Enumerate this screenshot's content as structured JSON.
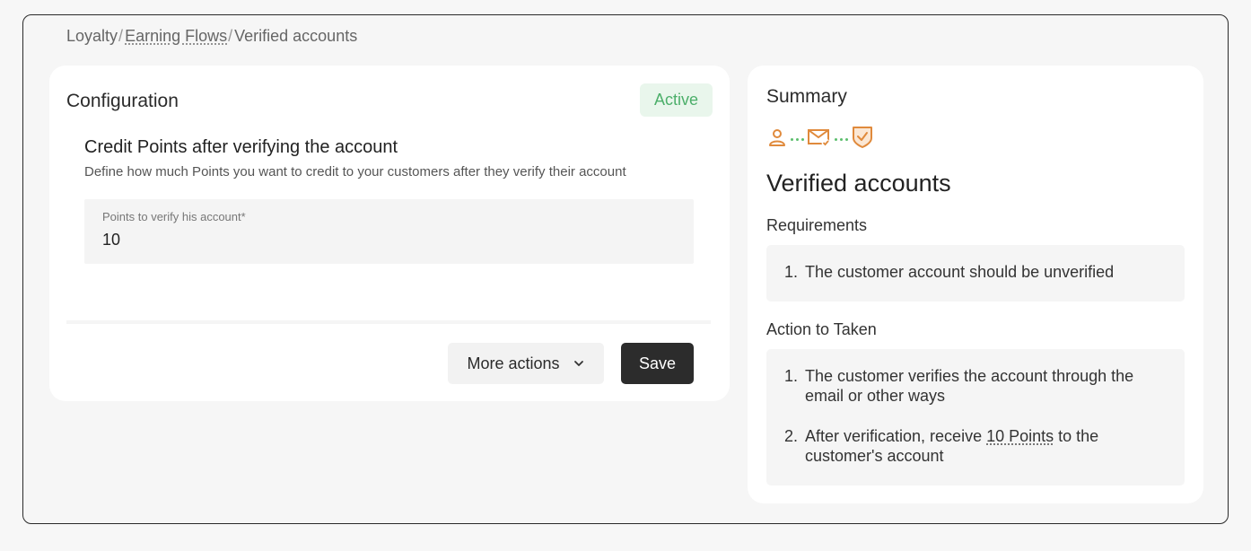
{
  "breadcrumb": {
    "items": [
      "Loyalty",
      "Earning Flows",
      "Verified accounts"
    ],
    "separator": "/"
  },
  "config": {
    "title": "Configuration",
    "status": "Active",
    "section_title": "Credit Points after verifying the account",
    "section_desc": "Define how much Points you want to credit to your customers after they verify their account",
    "field_label": "Points to verify his account*",
    "field_value": "10",
    "more_actions_label": "More actions",
    "save_label": "Save"
  },
  "summary": {
    "title": "Summary",
    "flow_icons": [
      "user-icon",
      "email-check-icon",
      "shield-check-icon"
    ],
    "heading": "Verified accounts",
    "requirements_label": "Requirements",
    "requirements": [
      {
        "num": "1.",
        "text": "The customer account should be unverified"
      }
    ],
    "action_label": "Action to Taken",
    "actions": [
      {
        "num": "1.",
        "text": "The customer verifies the account through the email or other ways"
      },
      {
        "num": "2.",
        "text_before": "After verification, receive ",
        "points": "10 Points",
        "text_after": " to the customer's account"
      }
    ]
  },
  "colors": {
    "accent_orange": "#e08a3c",
    "accent_green": "#4caf6a",
    "save_bg": "#2c2c2c"
  }
}
